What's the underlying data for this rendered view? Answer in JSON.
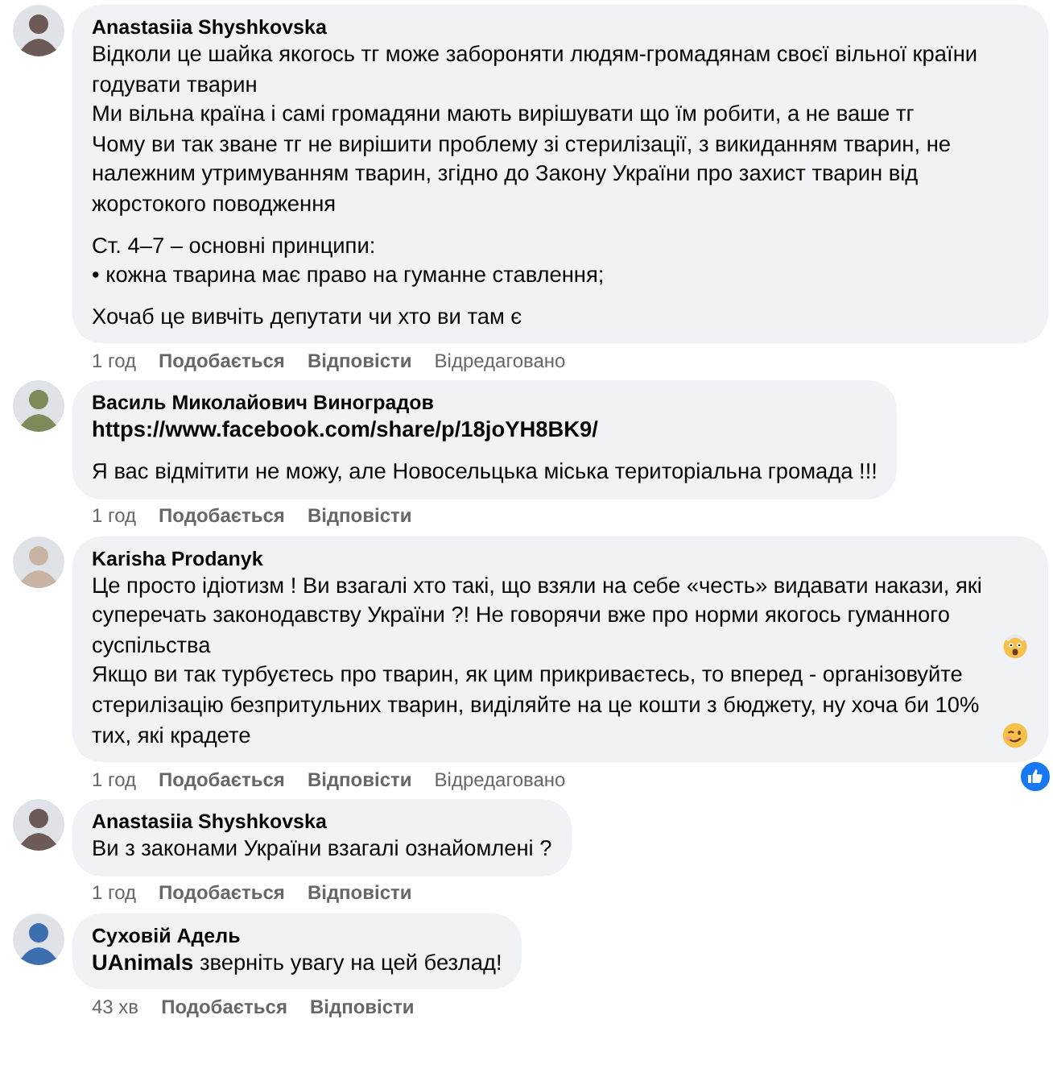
{
  "comments": [
    {
      "author": "Anastasiia Shyshkovska",
      "paragraphs": [
        [
          {
            "kind": "text",
            "text": "Відколи це шайка якогось тг може забороняти людям-громадянам своєї вільної країни годувати тварин"
          },
          {
            "kind": "text",
            "text": "Ми вільна країна і самі громадяни мають вирішувати що їм робити, а не ваше тг"
          },
          {
            "kind": "text",
            "text": "Чому ви так зване тг не вирішити проблему зі стерилізації, з викиданням тварин, не належним утримуванням тварин, згідно до Закону України про захист тварин від жорстокого поводження"
          }
        ],
        [
          {
            "kind": "text",
            "text": "Ст. 4–7 – основні принципи:"
          },
          {
            "kind": "text",
            "text": "• кожна тварина має право на гуманне ставлення;"
          }
        ],
        [
          {
            "kind": "text",
            "text": "Хочаб це вивчіть депутати чи хто ви там є"
          }
        ]
      ],
      "time": "1 год",
      "actions": [
        "Подобається",
        "Відповісти"
      ],
      "edited": "Відредаговано"
    },
    {
      "author": "Василь Миколайович Виноградов",
      "paragraphs": [
        [
          {
            "kind": "link",
            "text": "https://www.facebook.com/share/p/18joYH8BK9/"
          }
        ],
        [
          {
            "kind": "text",
            "text": "Я вас відмітити не можу, але Новосельцька міська територіальна громада !!!"
          }
        ]
      ],
      "time": "1 год",
      "actions": [
        "Подобається",
        "Відповісти"
      ]
    },
    {
      "author": "Karisha Prodanyk",
      "paragraphs": [
        [
          {
            "kind": "emoji-text",
            "text": "Це просто ідіотизм ! Ви взагалі хто такі, що взяли на себе «честь» видавати накази, які суперечать законодавству України ?! Не говорячи вже про норми якогось гуманного суспільства"
          },
          {
            "kind": "emoji-text",
            "text": "Якщо ви так турбуєтесь про тварин, як цим прикриваєтесь, то вперед - організовуйте стерилізацію безпритульних тварин, виділяйте на це кошти з бюджету, ну хоча би 10% тих, які крадете"
          }
        ]
      ],
      "time": "1 год",
      "actions": [
        "Подобається",
        "Відповісти"
      ],
      "edited": "Відредаговано",
      "liked": true
    },
    {
      "author": "Anastasiia Shyshkovska",
      "paragraphs": [
        [
          {
            "kind": "text",
            "text": "Ви з законами України взагалі ознайомлені ?"
          }
        ]
      ],
      "time": "1 год",
      "actions": [
        "Подобається",
        "Відповісти"
      ]
    },
    {
      "author": "Суховій Адель",
      "paragraphs": [
        [
          {
            "kind": "text",
            "text": "**UAnimals** зверніть увагу на цей безлад!"
          }
        ]
      ],
      "time": "43 хв",
      "actions": [
        "Подобається",
        "Відповісти"
      ]
    }
  ]
}
